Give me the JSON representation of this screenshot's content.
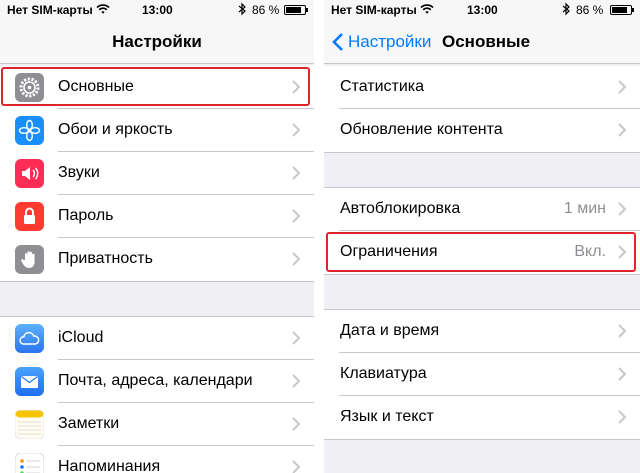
{
  "status_left": {
    "carrier": "Нет SIM-карты",
    "time": "13:00",
    "battery_pct": "86 %",
    "battery_level": 0.86
  },
  "status_right": {
    "carrier": "Нет SIM-карты",
    "time": "13:00",
    "battery_pct": "86 %",
    "battery_level": 0.86
  },
  "left": {
    "title": "Настройки",
    "items": [
      {
        "label": "Основные",
        "icon": "gear-icon",
        "color": "#8e8e93"
      },
      {
        "label": "Обои и яркость",
        "icon": "flower-icon",
        "color": "#1a8ffb"
      },
      {
        "label": "Звуки",
        "icon": "speaker-icon",
        "color": "#ff2d55"
      },
      {
        "label": "Пароль",
        "icon": "lock-icon",
        "color": "#ff3b30"
      },
      {
        "label": "Приватность",
        "icon": "hand-icon",
        "color": "#8e8e93"
      },
      {
        "label": "iCloud",
        "icon": "cloud-icon",
        "color": "#3a8df5"
      },
      {
        "label": "Почта, адреса, календари",
        "icon": "mail-icon",
        "color": "#1e7cf2"
      },
      {
        "label": "Заметки",
        "icon": "notes-icon",
        "color": "#f7c500"
      },
      {
        "label": "Напоминания",
        "icon": "reminders-icon",
        "color": "#ffffff"
      }
    ]
  },
  "right": {
    "back_label": "Настройки",
    "title": "Основные",
    "items": [
      {
        "label": "Статистика"
      },
      {
        "label": "Обновление контента"
      },
      {
        "label": "Автоблокировка",
        "value": "1 мин"
      },
      {
        "label": "Ограничения",
        "value": "Вкл."
      },
      {
        "label": "Дата и время"
      },
      {
        "label": "Клавиатура"
      },
      {
        "label": "Язык и текст"
      }
    ]
  },
  "colors": {
    "accent": "#007aff",
    "highlight": "#e0242b"
  }
}
